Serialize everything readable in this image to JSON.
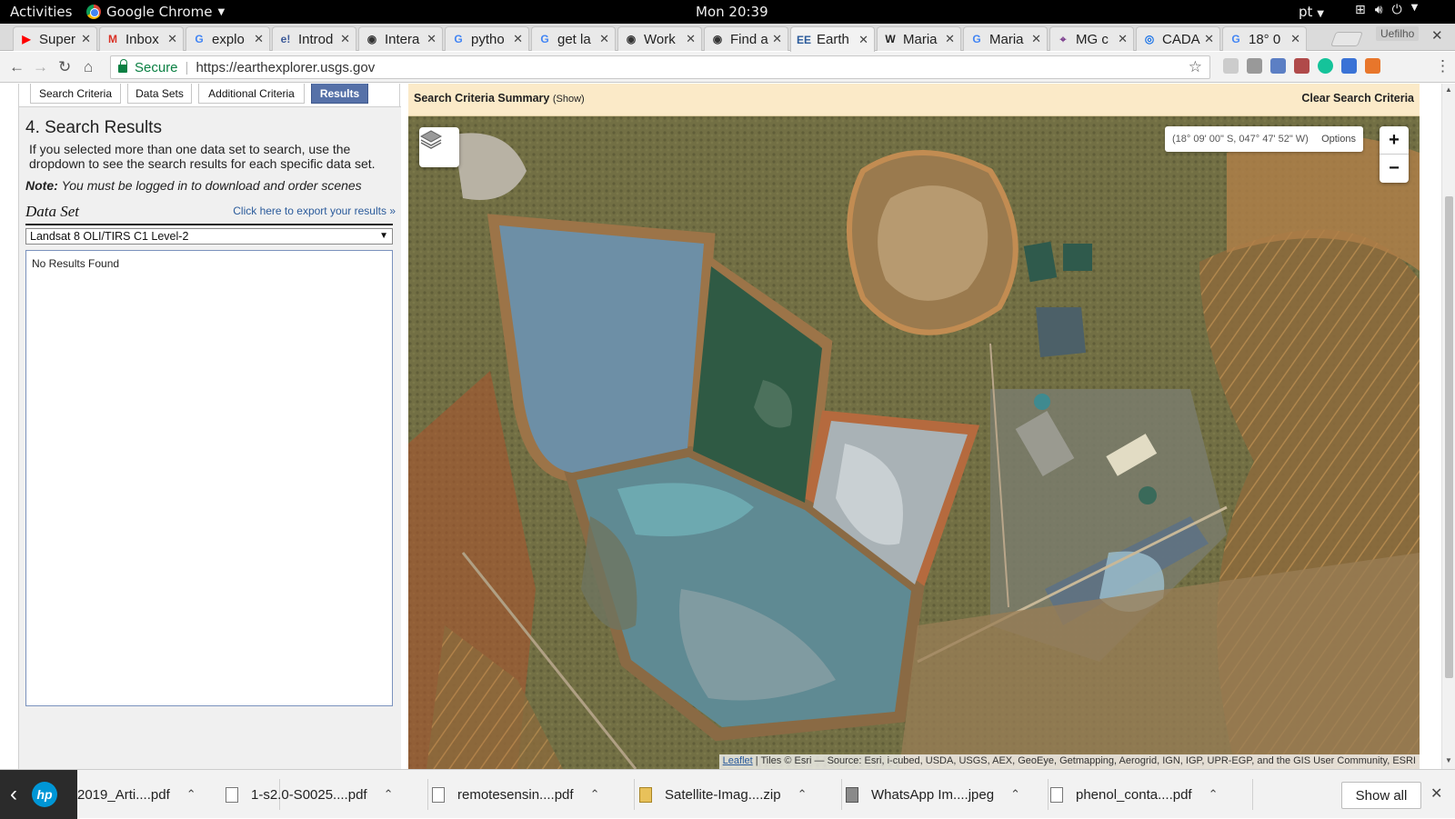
{
  "os_bar": {
    "activities": "Activities",
    "app_name": "Google Chrome",
    "clock": "Mon 20:39",
    "language": "pt"
  },
  "tabs": [
    {
      "label": "Super",
      "favicon": "youtube-icon",
      "color": "#ff0000"
    },
    {
      "label": "Inbox",
      "favicon": "gmail-icon",
      "color": "#d93025"
    },
    {
      "label": "explo",
      "favicon": "google-icon",
      "color": "#4285f4"
    },
    {
      "label": "Introd",
      "favicon": "e-icon",
      "color": "#3b5998"
    },
    {
      "label": "Intera",
      "favicon": "globe-icon",
      "color": "#333333"
    },
    {
      "label": "pytho",
      "favicon": "google-icon",
      "color": "#4285f4"
    },
    {
      "label": "get la",
      "favicon": "google-icon",
      "color": "#4285f4"
    },
    {
      "label": "Work",
      "favicon": "globe-icon",
      "color": "#333333"
    },
    {
      "label": "Find a",
      "favicon": "globe-icon",
      "color": "#333333"
    },
    {
      "label": "Earth",
      "favicon": "ee-icon",
      "color": "#2b5b9b",
      "active": true
    },
    {
      "label": "Maria",
      "favicon": "wikipedia-icon",
      "color": "#222222"
    },
    {
      "label": "Maria",
      "favicon": "google-icon",
      "color": "#4285f4"
    },
    {
      "label": "MG c",
      "favicon": "map-icon",
      "color": "#7a3b8c"
    },
    {
      "label": "CADA",
      "favicon": "circle-icon",
      "color": "#1a73e8"
    },
    {
      "label": "18° 0",
      "favicon": "google-icon",
      "color": "#4285f4"
    }
  ],
  "profile_label": "Uefilho",
  "address_bar": {
    "secure_label": "Secure",
    "url": "https://earthexplorer.usgs.gov"
  },
  "search_tabs": [
    {
      "label": "Search Criteria"
    },
    {
      "label": "Data Sets"
    },
    {
      "label": "Additional Criteria"
    },
    {
      "label": "Results",
      "active": true
    }
  ],
  "results": {
    "title": "4. Search Results",
    "description": "If you selected more than one data set to search, use the dropdown to see the search results for each specific data set.",
    "note_label": "Note:",
    "note_text": "You must be logged in to download and order scenes",
    "dataset_label": "Data Set",
    "export_link": "Click here to export your results »",
    "dataset_selected": "Landsat 8 OLI/TIRS C1 Level-2",
    "empty_message": "No Results Found"
  },
  "summary": {
    "title": "Search Criteria Summary",
    "show": "(Show)",
    "clear": "Clear Search Criteria"
  },
  "map": {
    "coordinates": "(18° 09' 00\" S, 047° 47' 52\" W)",
    "options": "Options",
    "zoom_in": "+",
    "zoom_out": "−",
    "attribution_link": "Leaflet",
    "attribution_text": " | Tiles © Esri — Source: Esri, i-cubed, USDA, USGS, AEX, GeoEye, Getmapping, Aerogrid, IGN, IGP, UPR-EGP, and the GIS User Community, ESRI"
  },
  "downloads": [
    {
      "name": "2019_Arti....pdf",
      "type": "pdf"
    },
    {
      "name": "1-s2.0-S0025....pdf",
      "type": "pdf"
    },
    {
      "name": "remotesensin....pdf",
      "type": "pdf"
    },
    {
      "name": "Satellite-Imag....zip",
      "type": "zip"
    },
    {
      "name": "WhatsApp Im....jpeg",
      "type": "image"
    },
    {
      "name": "phenol_conta....pdf",
      "type": "pdf"
    }
  ],
  "show_all": "Show all"
}
